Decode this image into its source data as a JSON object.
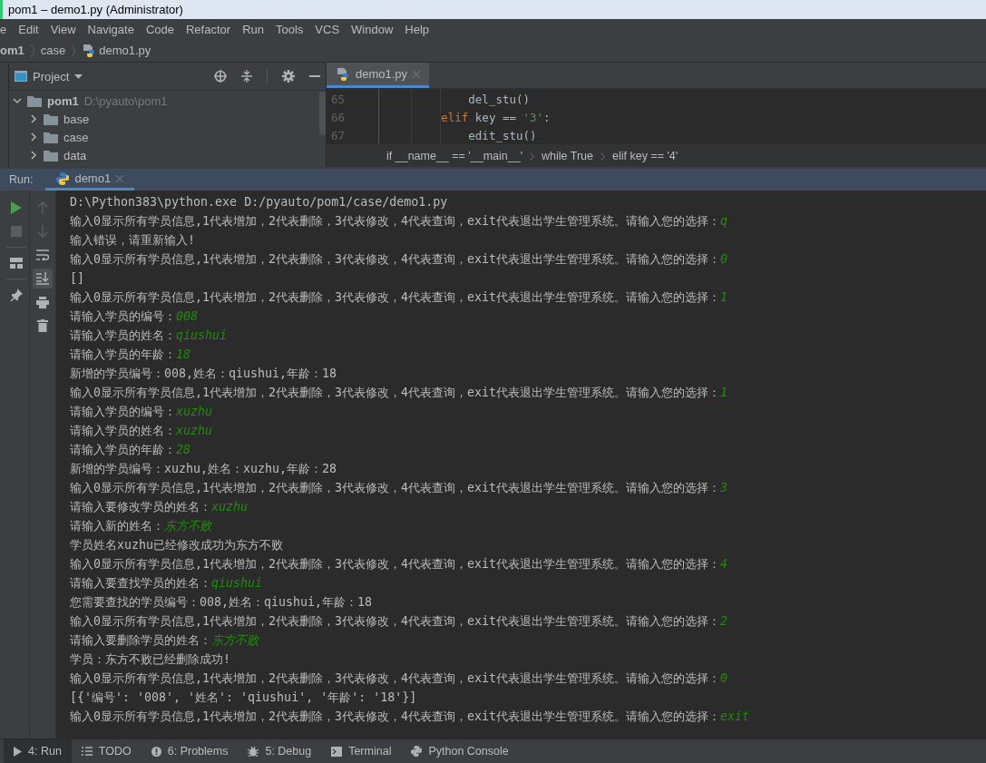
{
  "window": {
    "title": "pom1 – demo1.py (Administrator)"
  },
  "menu": [
    "e",
    "Edit",
    "View",
    "Navigate",
    "Code",
    "Refactor",
    "Run",
    "Tools",
    "VCS",
    "Window",
    "Help"
  ],
  "breadcrumb": [
    {
      "label": "om1",
      "kind": "project"
    },
    {
      "label": "case",
      "kind": "folder"
    },
    {
      "label": "demo1.py",
      "kind": "file"
    }
  ],
  "project_panel": {
    "title": "Project",
    "tree": [
      {
        "name": "pom1",
        "path": "D:\\pyauto\\pom1",
        "expanded": true,
        "children": [
          {
            "name": "base",
            "expanded": false
          },
          {
            "name": "case",
            "expanded": false
          },
          {
            "name": "data",
            "expanded": false
          }
        ]
      }
    ]
  },
  "editor": {
    "tabs": [
      {
        "label": "demo1.py",
        "selected": true
      }
    ],
    "lines": [
      {
        "number": "65",
        "tokens": [
          {
            "kind": "plain",
            "text": "            del_stu()"
          }
        ]
      },
      {
        "number": "66",
        "tokens": [
          {
            "kind": "keyword",
            "text": "        elif"
          },
          {
            "kind": "plain",
            "text": " key == "
          },
          {
            "kind": "string",
            "text": "'3'"
          },
          {
            "kind": "plain",
            "text": ":"
          }
        ]
      },
      {
        "number": "67",
        "tokens": [
          {
            "kind": "plain",
            "text": "            edit_stu()"
          }
        ]
      }
    ],
    "breadcrumbs": [
      "if __name__ == '__main__'",
      "while True",
      "elif key == '4'"
    ]
  },
  "run_panel": {
    "label": "Run:",
    "tabs": [
      {
        "label": "demo1",
        "selected": true
      }
    ],
    "left_tools": [
      {
        "kind": "run",
        "disabled": false
      },
      {
        "kind": "stop",
        "disabled": true
      },
      {
        "kind": "layout",
        "disabled": false
      },
      {
        "kind": "pin",
        "disabled": false
      }
    ],
    "right_tools": [
      {
        "kind": "up",
        "on": false
      },
      {
        "kind": "down",
        "on": false
      },
      {
        "kind": "wrap",
        "on": false
      },
      {
        "kind": "scroll-end",
        "on": true
      },
      {
        "kind": "print",
        "on": false
      },
      {
        "kind": "trash",
        "on": false
      }
    ],
    "console": [
      {
        "text": "D:\\Python383\\python.exe D:/pyauto/pom1/case/demo1.py"
      },
      {
        "text": "输入0显示所有学员信息,1代表增加，2代表删除，3代表修改，4代表查询，exit代表退出学生管理系统。请输入您的选择：",
        "input": "q"
      },
      {
        "text": "输入错误，请重新输入!"
      },
      {
        "text": "输入0显示所有学员信息,1代表增加，2代表删除，3代表修改，4代表查询，exit代表退出学生管理系统。请输入您的选择：",
        "input": "0"
      },
      {
        "text": "[]"
      },
      {
        "text": "输入0显示所有学员信息,1代表增加，2代表删除，3代表修改，4代表查询，exit代表退出学生管理系统。请输入您的选择：",
        "input": "1"
      },
      {
        "text": "请输入学员的编号：",
        "input": "008"
      },
      {
        "text": "请输入学员的姓名：",
        "input": "qiushui"
      },
      {
        "text": "请输入学员的年龄：",
        "input": "18"
      },
      {
        "text": "新增的学员编号：008,姓名：qiushui,年龄：18"
      },
      {
        "text": "输入0显示所有学员信息,1代表增加，2代表删除，3代表修改，4代表查询，exit代表退出学生管理系统。请输入您的选择：",
        "input": "1"
      },
      {
        "text": "请输入学员的编号：",
        "input": "xuzhu"
      },
      {
        "text": "请输入学员的姓名：",
        "input": "xuzhu"
      },
      {
        "text": "请输入学员的年龄：",
        "input": "28"
      },
      {
        "text": "新增的学员编号：xuzhu,姓名：xuzhu,年龄：28"
      },
      {
        "text": "输入0显示所有学员信息,1代表增加，2代表删除，3代表修改，4代表查询，exit代表退出学生管理系统。请输入您的选择：",
        "input": "3"
      },
      {
        "text": "请输入要修改学员的姓名：",
        "input": "xuzhu"
      },
      {
        "text": "请输入新的姓名：",
        "input": "东方不败"
      },
      {
        "text": "学员姓名xuzhu已经修改成功为东方不败"
      },
      {
        "text": "输入0显示所有学员信息,1代表增加，2代表删除，3代表修改，4代表查询，exit代表退出学生管理系统。请输入您的选择：",
        "input": "4"
      },
      {
        "text": "请输入要查找学员的姓名：",
        "input": "qiushui"
      },
      {
        "text": "您需要查找的学员编号：008,姓名：qiushui,年龄：18"
      },
      {
        "text": "输入0显示所有学员信息,1代表增加，2代表删除，3代表修改，4代表查询，exit代表退出学生管理系统。请输入您的选择：",
        "input": "2"
      },
      {
        "text": "请输入要删除学员的姓名：",
        "input": "东方不败"
      },
      {
        "text": "学员：东方不败已经删除成功!"
      },
      {
        "text": "输入0显示所有学员信息,1代表增加，2代表删除，3代表修改，4代表查询，exit代表退出学生管理系统。请输入您的选择：",
        "input": "0"
      },
      {
        "text": "[{'编号': '008', '姓名': 'qiushui', '年龄': '18'}]"
      },
      {
        "text": "输入0显示所有学员信息,1代表增加，2代表删除，3代表修改，4代表查询，exit代表退出学生管理系统。请输入您的选择：",
        "input": "exit"
      }
    ]
  },
  "bottom_tabs": [
    {
      "label": "4: Run",
      "kind": "run",
      "selected": true
    },
    {
      "label": "TODO",
      "kind": "todo",
      "selected": false
    },
    {
      "label": "6: Problems",
      "kind": "problems",
      "selected": false
    },
    {
      "label": "5: Debug",
      "kind": "debug",
      "selected": false
    },
    {
      "label": "Terminal",
      "kind": "terminal",
      "selected": false
    },
    {
      "label": "Python Console",
      "kind": "python",
      "selected": false
    }
  ]
}
